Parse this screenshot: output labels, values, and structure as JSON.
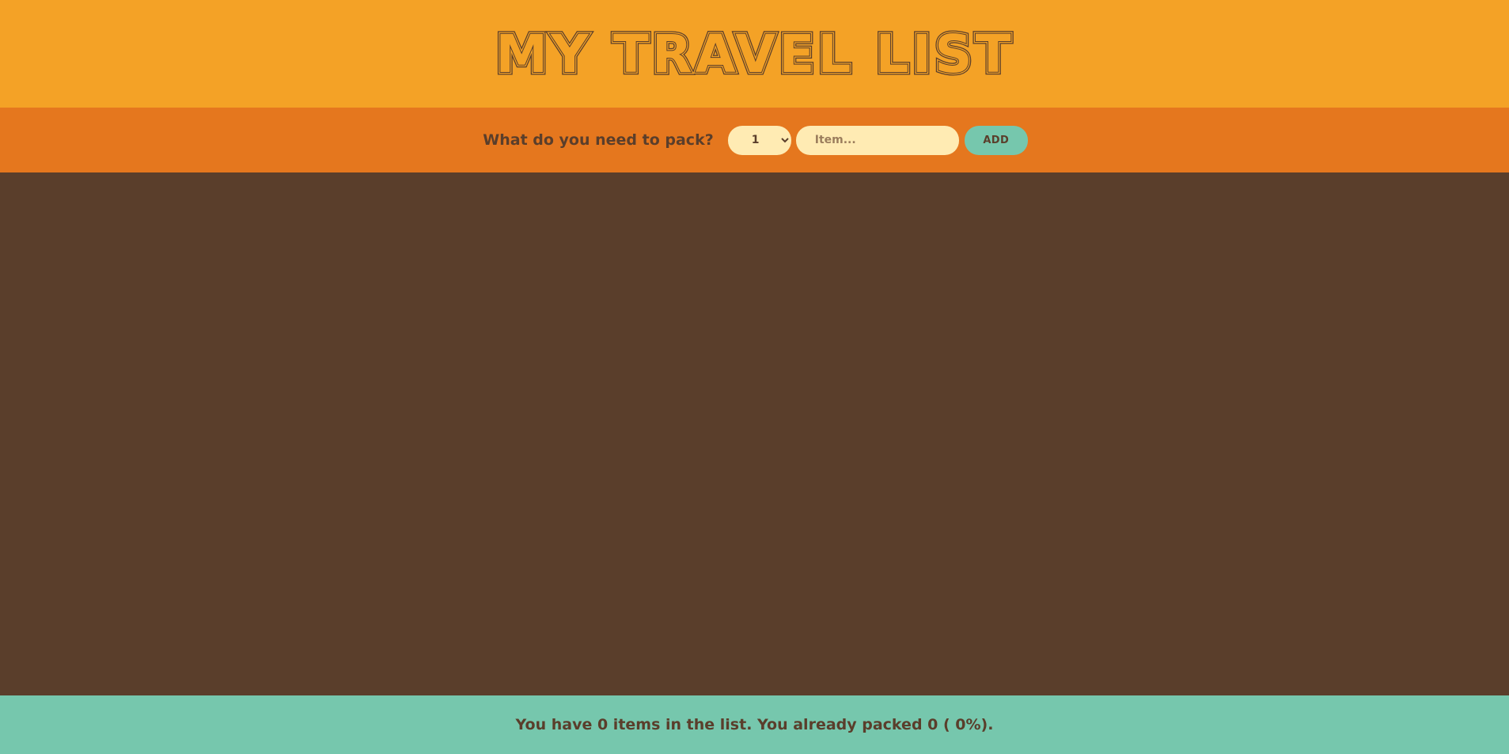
{
  "header": {
    "title": "MY TRAVEL LIST"
  },
  "form": {
    "question": "What do you need to pack?",
    "quantity_value": "1",
    "item_placeholder": "Item...",
    "add_label": "ADD"
  },
  "list": {
    "items": []
  },
  "stats": {
    "text": "You have 0 items in the list. You already packed 0 ( 0%)."
  },
  "colors": {
    "header_bg": "#f4a226",
    "form_bg": "#e5771e",
    "list_bg": "#5a3e2b",
    "stats_bg": "#76c7ad",
    "input_bg": "#ffebb3",
    "text_brown": "#5a3e2b"
  }
}
